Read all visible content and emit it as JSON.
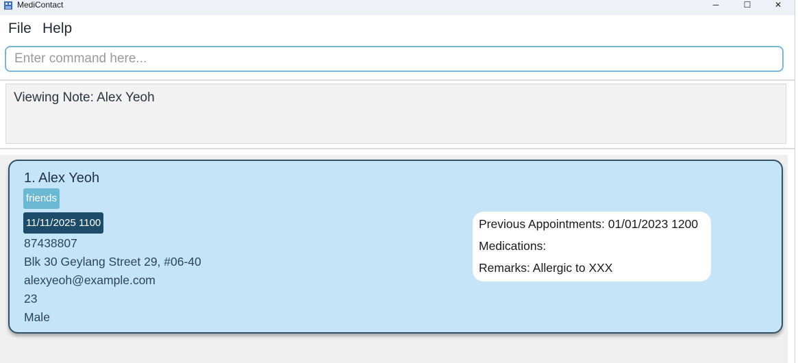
{
  "window": {
    "title": "MediContact",
    "minimize_glyph": "─",
    "maximize_glyph": "☐",
    "close_glyph": "✕"
  },
  "menu": {
    "items": [
      {
        "label": "File"
      },
      {
        "label": "Help"
      }
    ]
  },
  "command": {
    "placeholder": "Enter command here...",
    "value": ""
  },
  "result": {
    "text": "Viewing Note: Alex Yeoh"
  },
  "persons": [
    {
      "index_name": "1. Alex Yeoh",
      "tags": [
        "friends"
      ],
      "appointment": "11/11/2025 1100",
      "phone": "87438807",
      "address": "Blk 30 Geylang Street 29, #06-40",
      "email": "alexyeoh@example.com",
      "age": "23",
      "sex": "Male",
      "notes": {
        "previous_appointments": "Previous Appointments: 01/01/2023 1200",
        "medications": "Medications:",
        "remarks": "Remarks: Allergic to XXX"
      }
    }
  ],
  "colors": {
    "card_bg": "#c6e4f8",
    "card_border": "#2e506a",
    "tag_friends": "#6ab8d4",
    "tag_appointment": "#1d4b6a",
    "input_border": "#7cb5d6"
  }
}
